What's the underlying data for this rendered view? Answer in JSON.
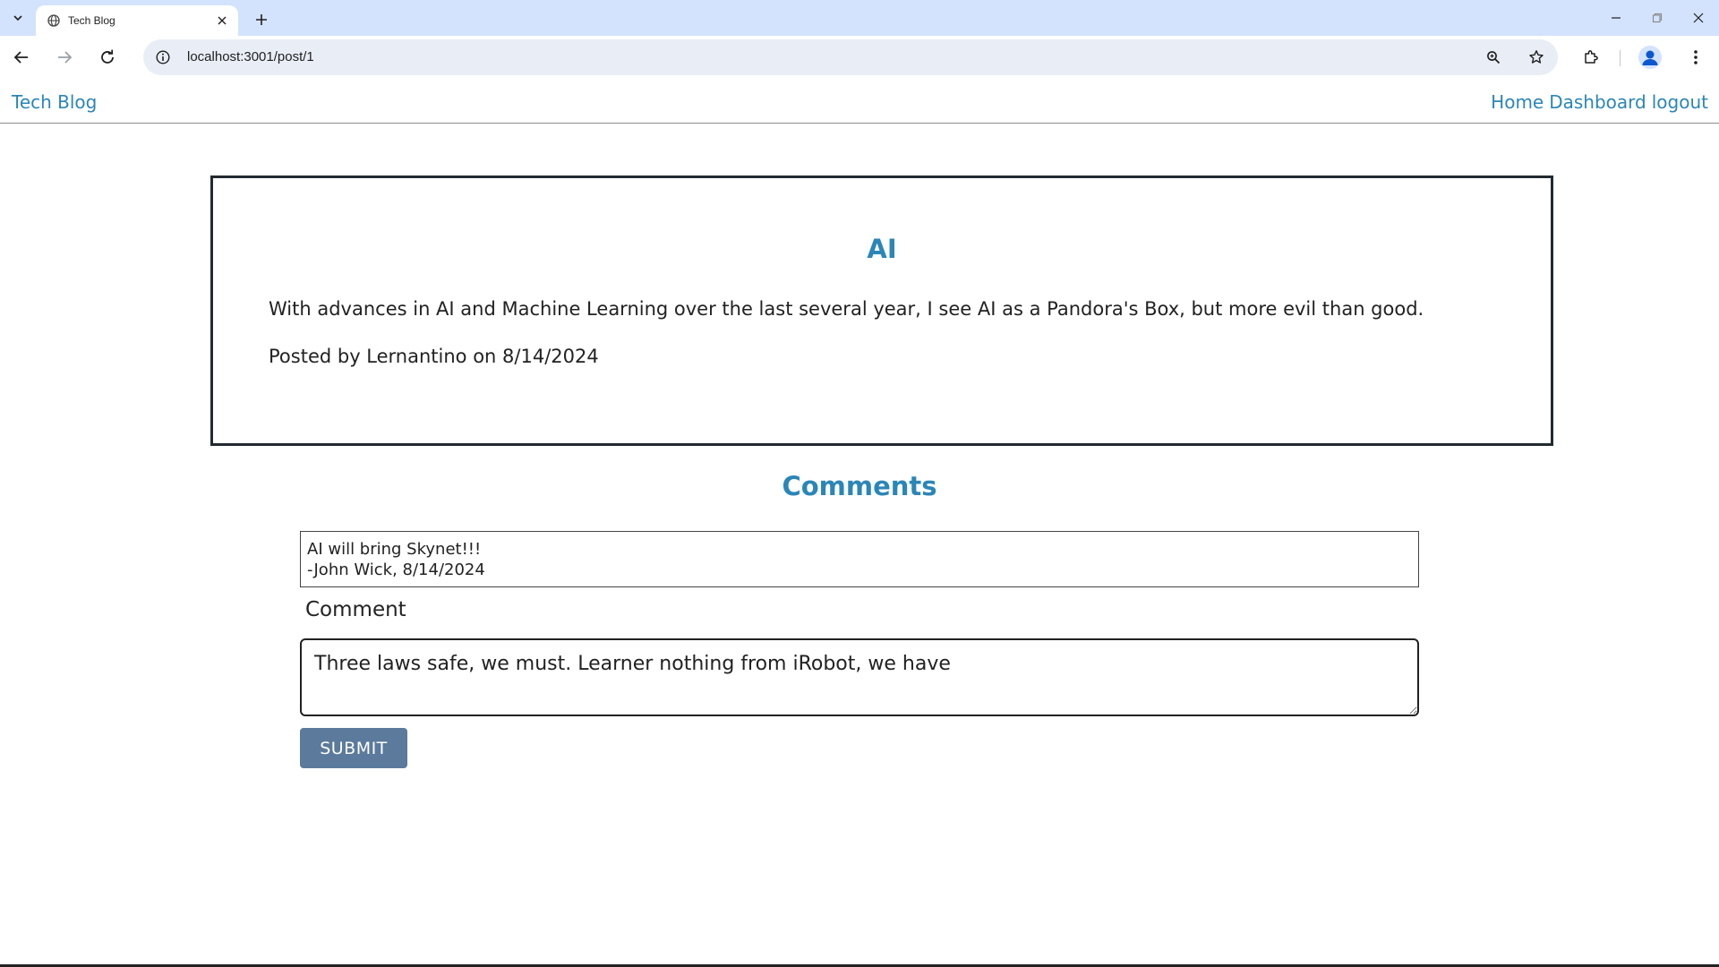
{
  "browser": {
    "tab_title": "Tech Blog",
    "url": "localhost:3001/post/1"
  },
  "site": {
    "brand": "Tech Blog",
    "nav": {
      "home": "Home",
      "dashboard": "Dashboard",
      "logout": "logout"
    }
  },
  "post": {
    "title": "AI",
    "body": "With advances in AI and Machine Learning over the last several year, I see AI as a Pandora's Box, but more evil than good.",
    "meta": "Posted by Lernantino on 8/14/2024"
  },
  "comments": {
    "heading": "Comments",
    "items": [
      {
        "text": "AI will bring Skynet!!!",
        "byline": "-John Wick, 8/14/2024"
      }
    ]
  },
  "form": {
    "label": "Comment",
    "value": "Three laws safe, we must. Learner nothing from iRobot, we have",
    "submit_label": "SUBMIT"
  },
  "colors": {
    "accent": "#2b86b8",
    "button": "#5b7a9c",
    "tabstrip": "#d3e3fd"
  }
}
